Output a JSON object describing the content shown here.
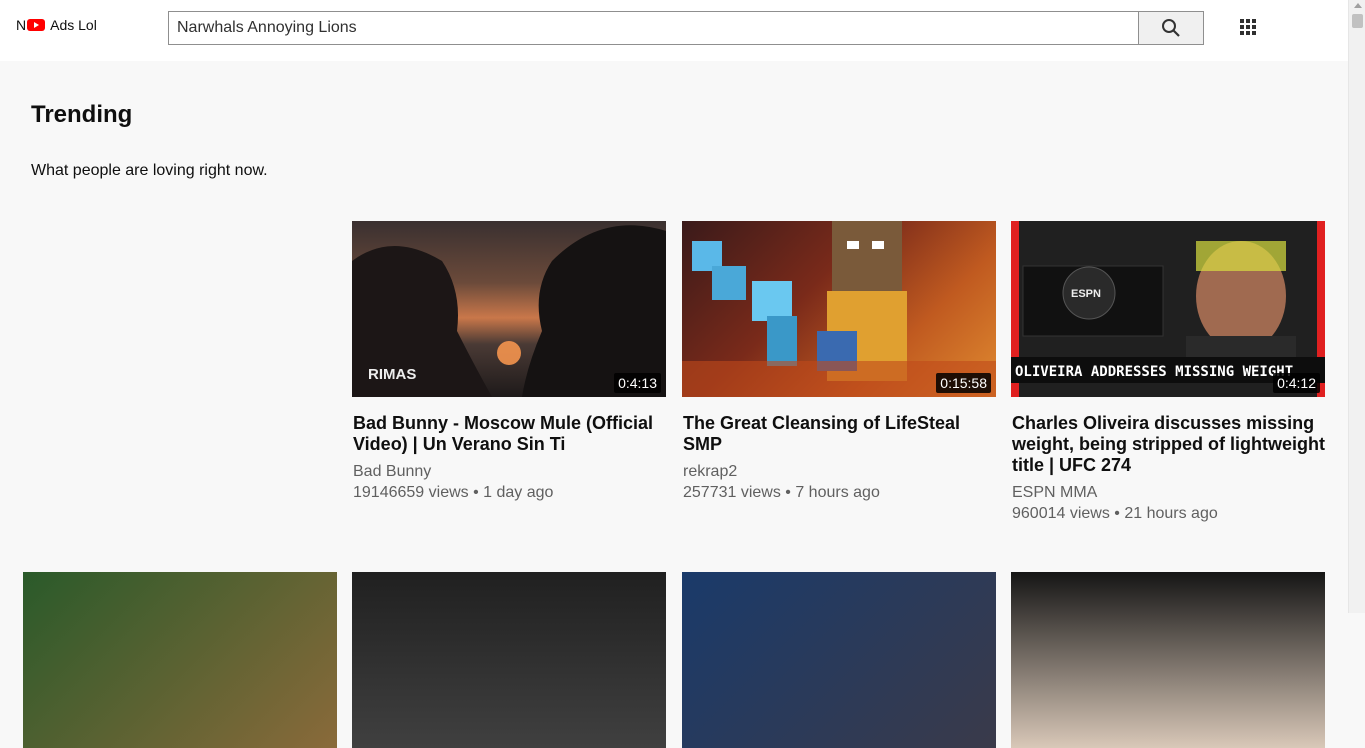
{
  "header": {
    "logo_letter": "N",
    "logo_text": "Ads Lol",
    "search_value": "Narwhals Annoying Lions",
    "search_icon": "search-icon",
    "apps_icon": "grid-apps-icon"
  },
  "section": {
    "title": "Trending",
    "subtitle": "What people are loving right now."
  },
  "videos": [
    {
      "title": "Bad Bunny - Moscow Mule (Official Video) | Un Verano Sin Ti",
      "channel": "Bad Bunny",
      "meta": "19146659 views • 1 day ago",
      "duration": "0:4:13",
      "thumb_text": "RIMAS"
    },
    {
      "title": "The Great Cleansing of LifeSteal SMP",
      "channel": "rekrap2",
      "meta": "257731 views • 7 hours ago",
      "duration": "0:15:58"
    },
    {
      "title": "Charles Oliveira discusses missing weight, being stripped of lightweight title | UFC 274",
      "channel": "ESPN MMA",
      "meta": "960014 views • 21 hours ago",
      "duration": "0:4:12",
      "thumb_text": "OLIVEIRA ADDRESSES MISSING WEIGHT"
    }
  ]
}
